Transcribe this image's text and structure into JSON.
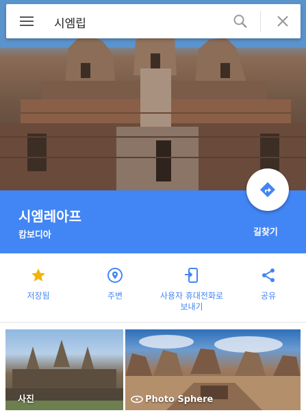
{
  "search": {
    "query": "시엠립"
  },
  "place": {
    "name": "시엠레아프",
    "country": "캄보디아",
    "directions_label": "길찾기"
  },
  "actions": [
    {
      "label": "저장됨",
      "icon": "star-icon"
    },
    {
      "label": "주변",
      "icon": "nearby-pin-icon"
    },
    {
      "label": "사용자 휴대전화로 보내기",
      "icon": "send-to-phone-icon"
    },
    {
      "label": "공유",
      "icon": "share-icon"
    }
  ],
  "photos": [
    {
      "label": "사진"
    },
    {
      "label": "Photo Sphere"
    }
  ],
  "colors": {
    "accent": "#4285f4",
    "star": "#f4b400"
  }
}
